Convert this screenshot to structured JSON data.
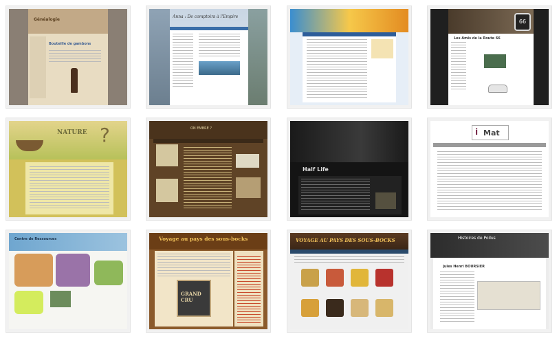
{
  "thumbnails": [
    {
      "title": "Généalogie",
      "post": "Bouteille de gambons"
    },
    {
      "title": "Anna : De comptoirs à l'Empire"
    },
    {
      "title": ""
    },
    {
      "title": "Les Amis de la Route 66",
      "sign": "66"
    },
    {
      "title": "NATURE",
      "q": "?"
    },
    {
      "title": "ON EMBRE ?"
    },
    {
      "title": "Half Life"
    },
    {
      "logo_i": "i",
      "logo_m": "Mat"
    },
    {
      "title": "Centre de Ressources"
    },
    {
      "title": "Voyage au pays des sous-bocks",
      "coaster": "GRAND CRU"
    },
    {
      "title": "VOYAGE AU PAYS DES SOUS-BOCKS"
    },
    {
      "title": "Histoires de Poilus",
      "name": "Jules Henri BOURSIER"
    }
  ]
}
